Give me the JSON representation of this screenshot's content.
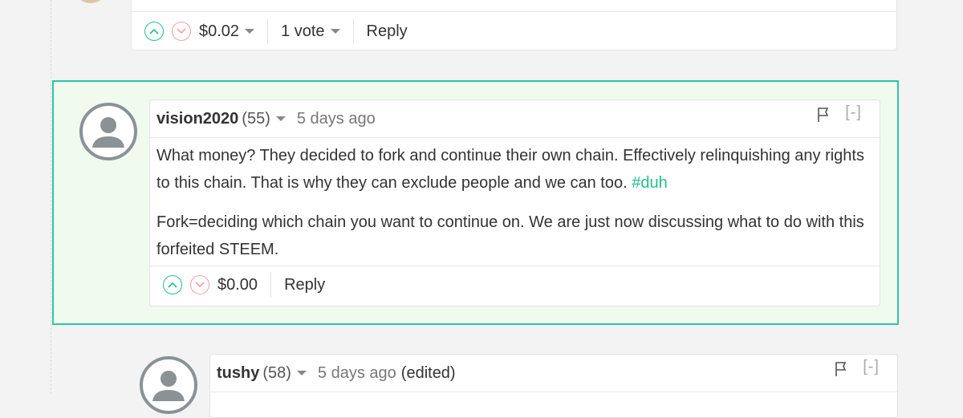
{
  "previous_comment": {
    "body_fragment": "",
    "payout": "$0.02",
    "votes": "1 vote",
    "reply_label": "Reply"
  },
  "highlighted_comment": {
    "author": "vision2020",
    "reputation": "(55)",
    "time_ago": "5 days ago",
    "collapse_label": "[-]",
    "paragraph_1": "What money? They decided to fork and continue their own chain. Effectively relinquishing any rights to this chain. That is why they can exclude people and we can too. ",
    "hashtag": "#duh",
    "paragraph_2": "Fork=deciding which chain you want to continue on. We are just now discussing what to do with this forfeited STEEM.",
    "payout": "$0.00",
    "reply_label": "Reply"
  },
  "reply_comment": {
    "author": "tushy",
    "reputation": "(58)",
    "time_ago": "5 days ago",
    "edited_label": "(edited)",
    "collapse_label": "[-]"
  },
  "colors": {
    "accent": "#1fbf8f",
    "highlight_border": "#2cc7a6",
    "highlight_bg": "#f1faef",
    "downvote": "#f4a0a0"
  },
  "icons": {
    "upvote": "chevron-up-circle-icon",
    "downvote": "chevron-down-circle-icon",
    "flag": "flag-icon",
    "dropdown": "caret-down-icon",
    "avatar": "user-avatar-icon"
  }
}
